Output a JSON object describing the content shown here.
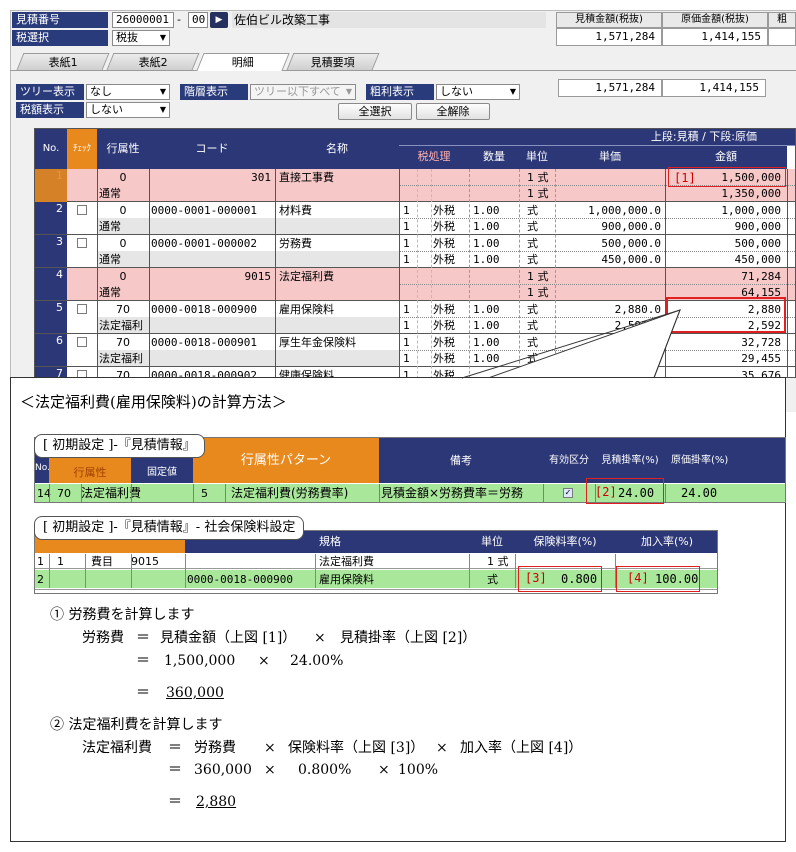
{
  "header": {
    "estimate_no_label": "見積番号",
    "estimate_no": "26000001",
    "estimate_sep": "-",
    "estimate_sub": "00",
    "project_name": "佐伯ビル改築工事",
    "tax_select_label": "税選択",
    "tax_select_value": "税抜",
    "col_estimate_amount": "見積金額(税抜)",
    "col_cost_amount": "原価金額(税抜)",
    "col_extra": "粗",
    "estimate_amount": "1,571,284",
    "cost_amount": "1,414,155"
  },
  "tabs": [
    "表紙1",
    "表紙2",
    "明細",
    "見積要項"
  ],
  "active_tab": "明細",
  "filters": {
    "tree_label": "ツリー表示",
    "tree_value": "なし",
    "level_label": "階層表示",
    "level_value": "ツリー以下すべて",
    "margin_label": "粗利表示",
    "margin_value": "しない",
    "taxamt_label": "税額表示",
    "taxamt_value": "しない",
    "select_all": "全選択",
    "deselect_all": "全解除",
    "estimate_amount": "1,571,284",
    "cost_amount": "1,414,155"
  },
  "grid": {
    "headers": {
      "no": "No.",
      "check": "ﾁｪｯｸ",
      "attr": "行属性",
      "code": "コード",
      "name": "名称",
      "group": "上段:見積 / 下段:原価",
      "tax": "税処理",
      "qty": "数量",
      "unit": "単位",
      "price": "単価",
      "amount": "金額"
    },
    "rows": [
      {
        "no": "1",
        "attr": "0",
        "attr2": "通常",
        "code": "301",
        "name": "直接工事費",
        "t1": "",
        "t2": "",
        "tax1a": "",
        "tax1b": "",
        "tax2a": "",
        "tax2b": "",
        "qty1": "",
        "qty2": "",
        "unit1": "1 式",
        "unit2": "1 式",
        "price1": "",
        "price2": "",
        "amt1": "1,500,000",
        "amt2": "1,350,000"
      },
      {
        "no": "2",
        "attr": "0",
        "attr2": "通常",
        "code": "0000-0001-000001",
        "name": "材料費",
        "tax1a": "1",
        "tax1b": "外税",
        "tax2a": "1",
        "tax2b": "外税",
        "qty1": "1.00",
        "qty2": "1.00",
        "unit1": "式",
        "unit2": "式",
        "price1": "1,000,000.0",
        "price2": "900,000.0",
        "amt1": "1,000,000",
        "amt2": "900,000"
      },
      {
        "no": "3",
        "attr": "0",
        "attr2": "通常",
        "code": "0000-0001-000002",
        "name": "労務費",
        "tax1a": "1",
        "tax1b": "外税",
        "tax2a": "1",
        "tax2b": "外税",
        "qty1": "1.00",
        "qty2": "1.00",
        "unit1": "式",
        "unit2": "式",
        "price1": "500,000.0",
        "price2": "450,000.0",
        "amt1": "500,000",
        "amt2": "450,000"
      },
      {
        "no": "4",
        "attr": "0",
        "attr2": "通常",
        "code": "9015",
        "name": "法定福利費",
        "tax1a": "",
        "tax1b": "",
        "tax2a": "",
        "tax2b": "",
        "qty1": "",
        "qty2": "",
        "unit1": "1 式",
        "unit2": "1 式",
        "price1": "",
        "price2": "",
        "amt1": "71,284",
        "amt2": "64,155"
      },
      {
        "no": "5",
        "attr": "70",
        "attr2": "法定福利",
        "code": "0000-0018-000900",
        "name": "雇用保険料",
        "tax1a": "1",
        "tax1b": "外税",
        "tax2a": "1",
        "tax2b": "外税",
        "qty1": "1.00",
        "qty2": "1.00",
        "unit1": "式",
        "unit2": "式",
        "price1": "2,880.0",
        "price2": "2,592.0",
        "amt1": "2,880",
        "amt2": "2,592"
      },
      {
        "no": "6",
        "attr": "70",
        "attr2": "法定福利",
        "code": "0000-0018-000901",
        "name": "厚生年金保険料",
        "tax1a": "1",
        "tax1b": "外税",
        "tax2a": "1",
        "tax2b": "外税",
        "qty1": "1.00",
        "qty2": "1.00",
        "unit1": "式",
        "unit2": "式",
        "price1": "",
        "price2": "",
        "amt1": "32,728",
        "amt2": "29,455"
      },
      {
        "no": "7",
        "attr": "70",
        "attr2": "",
        "code": "0000-0018-000902",
        "name": "健康保険料",
        "tax1a": "1",
        "tax1b": "外税",
        "tax2a": "",
        "tax2b": "",
        "qty1": "",
        "qty2": "",
        "unit1": "",
        "unit2": "",
        "price1": "",
        "price2": "",
        "amt1": "35,676",
        "amt2": ""
      }
    ]
  },
  "callout": {
    "title": "＜法定福利費(雇用保険料)の計算方法＞",
    "marker1": "[1]",
    "panel1": {
      "caption": "[ 初期設定 ]-『見積情報』",
      "h_no": "No.",
      "h_attr": "行属性",
      "h_fixed": "固定値",
      "h_pattern": "行属性パターン",
      "h_remark": "備考",
      "h_valid": "有効区分",
      "h_est_rate": "見積掛率(%)",
      "h_cost_rate": "原価掛率(%)",
      "no": "14",
      "attr_code": "70",
      "attr_name": "法定福利費",
      "pat_code": "5",
      "pat_name": "法定福利費(労務費率)",
      "remark": "見積金額×労務費率＝労務",
      "marker": "[2]",
      "est_rate": "24.00",
      "cost_rate": "24.00"
    },
    "panel2": {
      "caption": "[ 初期設定 ]-『見積情報』- 社会保険料設定",
      "h_spec": "規格",
      "h_unit": "単位",
      "h_rate": "保険料率(%)",
      "h_join": "加入率(%)",
      "r1_no": "1",
      "r1_a": "1",
      "r1_b": "費目",
      "r1_c": "9015",
      "r1_name": "法定福利費",
      "r1_unit": "1 式",
      "r2_no": "2",
      "r2_code": "0000-0018-000900",
      "r2_name": "雇用保険料",
      "r2_unit": "式",
      "marker3": "[3]",
      "rate": "0.800",
      "marker4": "[4]",
      "join": "100.00"
    },
    "calc": {
      "step1": "① 労務費を計算します",
      "s1_label": "労務費",
      "s1_eq": "＝",
      "s1_a": "見積金額（上図 [1]）",
      "s1_times": "×",
      "s1_b": "見積掛率（上図 [2]）",
      "s1_l2a": "1,500,000",
      "s1_l2b": "24.00%",
      "s1_result": "360,000",
      "step2": "② 法定福利費を計算します",
      "s2_label": "法定福利費",
      "s2_a": "労務費",
      "s2_b": "保険料率（上図 [3]）",
      "s2_c": "加入率（上図 [4]）",
      "s2_l2a": "360,000",
      "s2_l2b": "0.800%",
      "s2_l2c": "100%",
      "s2_result": "2,880"
    }
  }
}
